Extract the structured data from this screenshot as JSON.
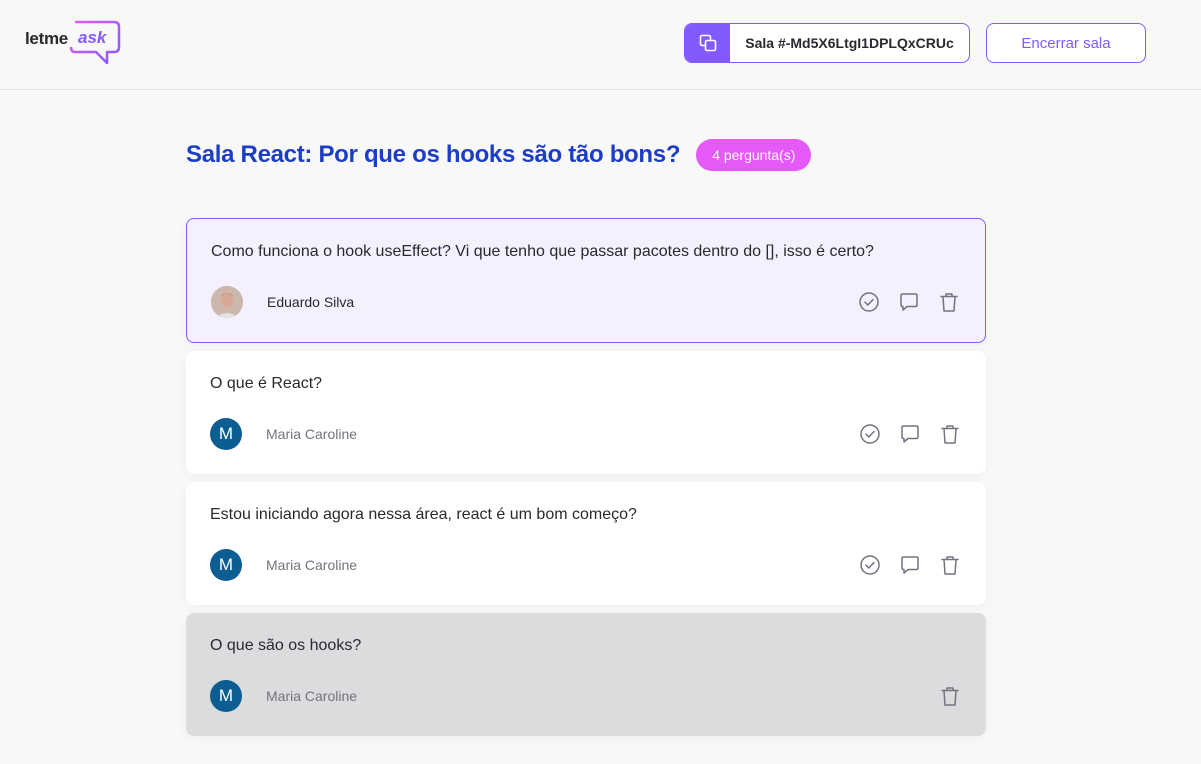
{
  "header": {
    "logo_letme": "letme",
    "logo_ask": "ask",
    "room_code_label": "Sala #-Md5X6LtgI1DPLQxCRUc",
    "copy_icon": "copy-icon",
    "close_room_label": "Encerrar sala"
  },
  "room": {
    "title": "Sala React: Por que os hooks são tão bons?",
    "question_count": "4 pergunta(s)"
  },
  "questions": [
    {
      "content": "Como funciona o hook useEffect? Vi que tenho que passar pacotes dentro do [], isso é certo?",
      "author": "Eduardo Silva",
      "avatar_type": "photo",
      "state": "highlighted"
    },
    {
      "content": "O que é React?",
      "author": "Maria Caroline",
      "avatar_initial": "M",
      "state": "normal"
    },
    {
      "content": "Estou iniciando agora nessa área, react é um bom começo?",
      "author": "Maria Caroline",
      "avatar_initial": "M",
      "state": "normal"
    },
    {
      "content": "O que são os hooks?",
      "author": "Maria Caroline",
      "avatar_initial": "M",
      "state": "answered"
    }
  ],
  "icons": {
    "check": "check-circle-icon",
    "answer": "chat-bubble-icon",
    "delete": "trash-icon"
  },
  "colors": {
    "brand": "#835afd",
    "title": "#1c3ec7",
    "badge": "#e559f9",
    "avatar": "#0c5d91"
  }
}
